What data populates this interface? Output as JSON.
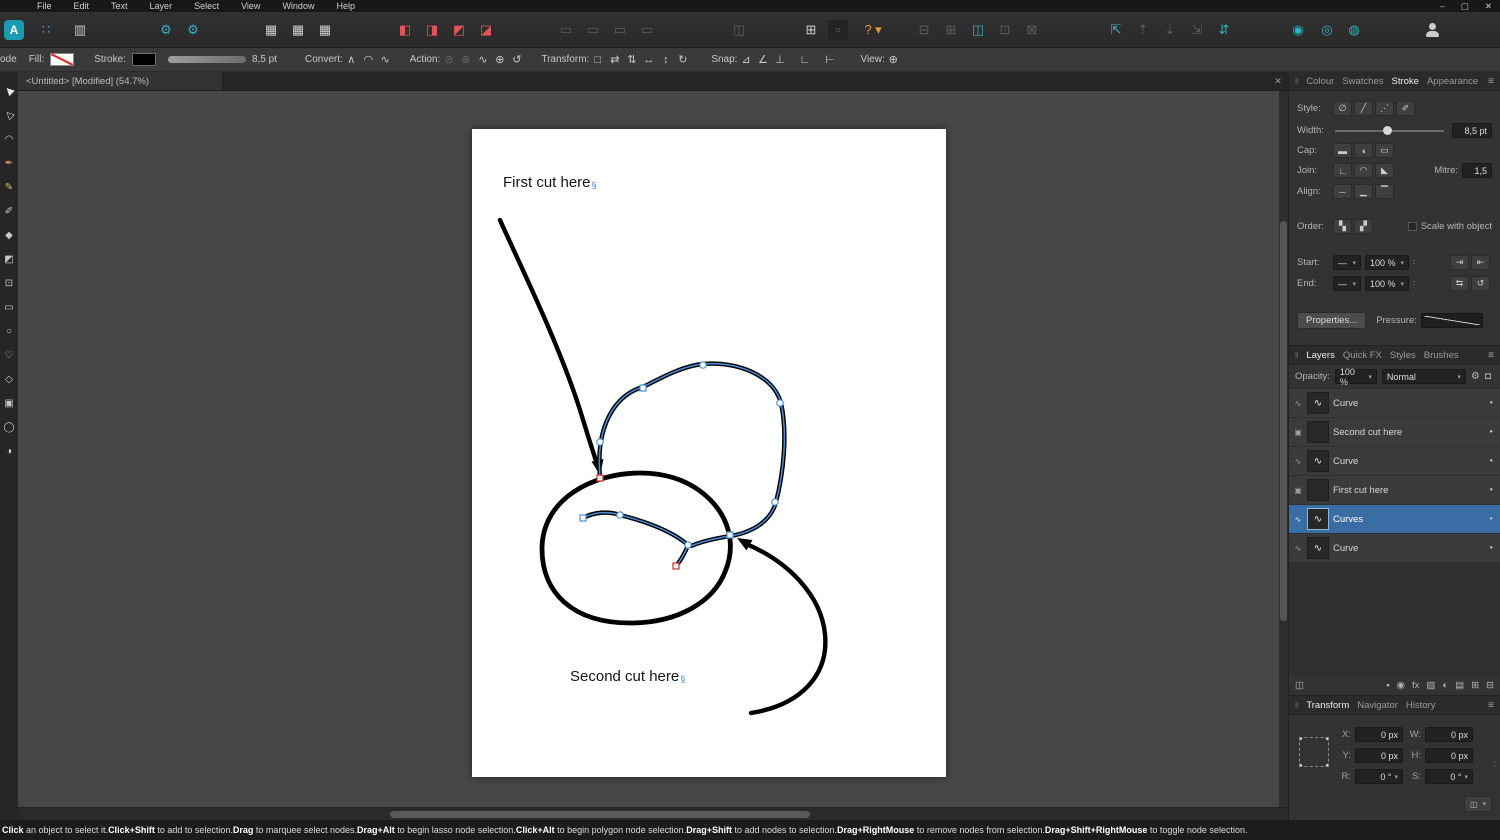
{
  "ui": {
    "hamburger": "≡",
    "grip": "‖",
    "dd_arrow": "▾",
    "visibility_dot": "●",
    "tab_close": "✕",
    "sync": "∶"
  },
  "window": {
    "controls": [
      {
        "name": "minimize-button",
        "glyph": "–"
      },
      {
        "name": "maximize-button",
        "glyph": "▢"
      },
      {
        "name": "close-button",
        "glyph": "✕"
      }
    ]
  },
  "menubar": {
    "items": [
      {
        "name": "menu-file",
        "label": "File"
      },
      {
        "name": "menu-edit",
        "label": "Edit"
      },
      {
        "name": "menu-text",
        "label": "Text"
      },
      {
        "name": "menu-layer",
        "label": "Layer"
      },
      {
        "name": "menu-select",
        "label": "Select"
      },
      {
        "name": "menu-view",
        "label": "View"
      },
      {
        "name": "menu-window",
        "label": "Window"
      },
      {
        "name": "menu-help",
        "label": "Help"
      }
    ]
  },
  "toolbar": {
    "icons": [
      {
        "name": "app-logo",
        "glyph": "A",
        "color": "#ffffff",
        "bg": "#1b9ab0",
        "gap": 4,
        "cls": "logo"
      },
      {
        "name": "apps-grid-icon",
        "glyph": "∷",
        "color": "#4fa3e3",
        "gap": 12
      },
      {
        "name": "document-stats-icon",
        "glyph": "▥",
        "color": "#c9c9c9",
        "gap": 14
      },
      {
        "name": "preferences-gear-icon",
        "glyph": "⚙",
        "color": "#2fb3c4",
        "gap": 66
      },
      {
        "name": "settings-gear-icon",
        "glyph": "⚙",
        "color": "#2fb3c4",
        "gap": 7
      },
      {
        "name": "grid-manager-icon",
        "glyph": "▦",
        "color": "#cfcfcf",
        "gap": 58
      },
      {
        "name": "grid-table-icon",
        "glyph": "▦",
        "color": "#cfcfcf",
        "gap": 7
      },
      {
        "name": "guides-icon",
        "glyph": "▦",
        "color": "#cfcfcf",
        "gap": 7
      },
      {
        "name": "boolean-add-icon",
        "glyph": "◧",
        "color": "#e05555",
        "gap": 60
      },
      {
        "name": "boolean-subtract-icon",
        "glyph": "◨",
        "color": "#e05555",
        "gap": 7
      },
      {
        "name": "boolean-intersect-icon",
        "glyph": "◩",
        "color": "#e05555",
        "gap": 7
      },
      {
        "name": "boolean-divide-icon",
        "glyph": "◪",
        "color": "#e05555",
        "gap": 7
      },
      {
        "name": "insert-behind-icon",
        "glyph": "▭",
        "color": "#5e5e5e",
        "gap": 60
      },
      {
        "name": "insert-top-icon",
        "glyph": "▭",
        "color": "#5e5e5e",
        "gap": 7
      },
      {
        "name": "insert-inside-icon",
        "glyph": "▭",
        "color": "#5e5e5e",
        "gap": 7
      },
      {
        "name": "insert-after-icon",
        "glyph": "▭",
        "color": "#5e5e5e",
        "gap": 7
      },
      {
        "name": "replace-selection-icon",
        "glyph": "◫",
        "color": "#5e5e5e",
        "gap": 72
      },
      {
        "name": "snapping-toggle-icon",
        "glyph": "⊞",
        "color": "#cfcfcf",
        "gap": 52
      },
      {
        "name": "snapping-preset-box",
        "glyph": "▫",
        "color": "#777777",
        "bg": "#232323",
        "gap": 7
      },
      {
        "name": "help-icon",
        "glyph": "? ▾",
        "color": "#e09a3e",
        "gap": 10,
        "w": 30
      },
      {
        "name": "selection-box-icon",
        "glyph": "⊟",
        "color": "#5e5e5e",
        "gap": 26
      },
      {
        "name": "selection-cycle-icon",
        "glyph": "⊞",
        "color": "#5e5e5e",
        "gap": 7
      },
      {
        "name": "edit-in-photo-icon",
        "glyph": "◫",
        "color": "#39aebc",
        "gap": 7
      },
      {
        "name": "rotate-left-icon",
        "glyph": "⊡",
        "color": "#5e5e5e",
        "gap": 7
      },
      {
        "name": "rotate-right-icon",
        "glyph": "⊠",
        "color": "#5e5e5e",
        "gap": 7
      },
      {
        "name": "arrange-to-front-icon",
        "glyph": "⇱",
        "color": "#39aebc",
        "gap": 64
      },
      {
        "name": "arrange-forward-icon",
        "glyph": "⇡",
        "color": "#5e5e5e",
        "gap": 7
      },
      {
        "name": "arrange-backward-icon",
        "glyph": "⇣",
        "color": "#5e5e5e",
        "gap": 7
      },
      {
        "name": "arrange-to-back-icon",
        "glyph": "⇲",
        "color": "#5e5e5e",
        "gap": 7
      },
      {
        "name": "arrange-order-icon",
        "glyph": "⇵",
        "color": "#39aebc",
        "gap": 7
      },
      {
        "name": "designer-persona-icon",
        "glyph": "◉",
        "color": "#2fb3c4",
        "gap": 54
      },
      {
        "name": "pixel-persona-icon",
        "glyph": "◎",
        "color": "#2fb3c4",
        "gap": 9
      },
      {
        "name": "export-persona-icon",
        "glyph": "◍",
        "color": "#2fb3c4",
        "gap": 7
      },
      {
        "name": "account-icon",
        "glyph": "",
        "color": "#cfcfcf",
        "gap": 58,
        "cls": "person"
      }
    ]
  },
  "context_bar": {
    "mode_label": "ode",
    "fill_label": "Fill:",
    "stroke_label": "Stroke:",
    "stroke_width_value": "8,5 pt",
    "convert_label": "Convert:",
    "convert_icons": [
      {
        "name": "convert-sharp-icon",
        "glyph": "∧"
      },
      {
        "name": "convert-smooth-icon",
        "glyph": "◠"
      },
      {
        "name": "convert-smart-icon",
        "glyph": "∿"
      }
    ],
    "action_label": "Action:",
    "action_icons": [
      {
        "name": "action-close-curve-icon",
        "glyph": "⊘",
        "dim": true
      },
      {
        "name": "action-break-curve-icon",
        "glyph": "⊗",
        "dim": true
      },
      {
        "name": "action-smooth-icon",
        "glyph": "∿"
      },
      {
        "name": "action-join-curves-icon",
        "glyph": "⊕"
      },
      {
        "name": "action-reverse-curves-icon",
        "glyph": "↺"
      }
    ],
    "transform_label": "Transform:",
    "transform_icons": [
      {
        "name": "bounding-box-icon",
        "glyph": "□"
      },
      {
        "name": "flip-horizontal-icon",
        "glyph": "⇄"
      },
      {
        "name": "flip-vertical-icon",
        "glyph": "⇅"
      },
      {
        "name": "scale-h-icon",
        "glyph": "↔"
      },
      {
        "name": "scale-v-icon",
        "glyph": "↕"
      },
      {
        "name": "rotate-icon",
        "glyph": "↻"
      }
    ],
    "snap_label": "Snap:",
    "snap_icons": [
      {
        "name": "snap-to-geometry-icon",
        "glyph": "⊿"
      },
      {
        "name": "snap-off-curve-icon",
        "glyph": "∠"
      },
      {
        "name": "snap-construct-icon",
        "glyph": "⊥"
      },
      {
        "name": "snap-alignment-icon",
        "glyph": "∟",
        "gap": 8
      },
      {
        "name": "snap-perpendicular-icon",
        "glyph": "⊢",
        "gap": 8
      }
    ],
    "view_label": "View:",
    "view_icons": [
      {
        "name": "view-points-icon",
        "glyph": "⊕"
      }
    ]
  },
  "document": {
    "tab_title": "<Untitled> [Modified] (54.7%)"
  },
  "tools": {
    "items": [
      {
        "name": "move-tool",
        "glyph": "▶",
        "color": "#e8e8e8",
        "rot": -135
      },
      {
        "name": "node-tool",
        "glyph": "▷",
        "color": "#d8d8d8",
        "rot": -135
      },
      {
        "name": "corner-tool",
        "glyph": "◠",
        "color": "#c9c9c9"
      },
      {
        "name": "pen-tool",
        "glyph": "✒",
        "color": "#d98b5a"
      },
      {
        "name": "pencil-tool",
        "glyph": "✎",
        "color": "#d8c25a"
      },
      {
        "name": "vector-brush-tool",
        "glyph": "✐",
        "color": "#c9c9c9"
      },
      {
        "name": "fill-tool",
        "glyph": "◆",
        "color": "#c9c9c9"
      },
      {
        "name": "transparency-tool",
        "glyph": "◩",
        "color": "#c9c9c9"
      },
      {
        "name": "vector-crop-tool",
        "glyph": "⊡",
        "color": "#c9c9c9"
      },
      {
        "name": "rectangle-tool",
        "glyph": "▭",
        "color": "#c9c9c9"
      },
      {
        "name": "ellipse-tool",
        "glyph": "○",
        "color": "#c9c9c9"
      },
      {
        "name": "heart-shape-tool",
        "glyph": "♡",
        "color": "#c9c9c9"
      },
      {
        "name": "shape-tool",
        "glyph": "◇",
        "color": "#c9c9c9"
      },
      {
        "name": "text-tool",
        "glyph": "▣",
        "color": "#c9c9c9"
      },
      {
        "name": "zoom-tool",
        "glyph": "◯",
        "color": "#c9c9c9"
      },
      {
        "name": "colour-selector-tool",
        "glyph": "◑",
        "color": "#e0e0e0"
      }
    ]
  },
  "canvas": {
    "first_label": "First cut here",
    "second_label": "Second cut here",
    "overflow_marker": "§"
  },
  "stroke_panel": {
    "tabs": [
      {
        "name": "tab-colour",
        "label": "Colour"
      },
      {
        "name": "tab-swatches",
        "label": "Swatches"
      },
      {
        "name": "tab-stroke",
        "label": "Stroke",
        "active": true
      },
      {
        "name": "tab-appearance",
        "label": "Appearance"
      }
    ],
    "style_label": "Style:",
    "style_buttons": [
      {
        "name": "no-stroke-icon",
        "glyph": "∅"
      },
      {
        "name": "solid-stroke-icon",
        "glyph": "╱"
      },
      {
        "name": "dash-stroke-icon",
        "glyph": "⋰"
      },
      {
        "name": "brush-stroke-icon",
        "glyph": "✐"
      }
    ],
    "width_label": "Width:",
    "width_value": "8,5 pt",
    "cap_label": "Cap:",
    "cap_buttons": [
      {
        "name": "butt-cap-icon",
        "glyph": "▬"
      },
      {
        "name": "round-cap-icon",
        "glyph": "◖"
      },
      {
        "name": "square-cap-icon",
        "glyph": "▭"
      }
    ],
    "join_label": "Join:",
    "join_buttons": [
      {
        "name": "mitre-join-icon",
        "glyph": "∟"
      },
      {
        "name": "round-join-icon",
        "glyph": "◠"
      },
      {
        "name": "bevel-join-icon",
        "glyph": "◣"
      }
    ],
    "mitre_label": "Mitre:",
    "mitre_value": "1,5",
    "align_label": "Align:",
    "align_buttons": [
      {
        "name": "align-centre-icon",
        "glyph": "─"
      },
      {
        "name": "align-inside-icon",
        "glyph": "▁"
      },
      {
        "name": "align-outside-icon",
        "glyph": "▔"
      }
    ],
    "order_label": "Order:",
    "order_buttons": [
      {
        "name": "stroke-behind-fill-icon",
        "glyph": "▚"
      },
      {
        "name": "stroke-in-front-icon",
        "glyph": "▞"
      }
    ],
    "scale_with_object_label": "Scale with object",
    "start_label": "Start:",
    "end_label": "End:",
    "start_style_value": "—",
    "start_pct_value": "100 %",
    "end_style_value": "—",
    "end_pct_value": "100 %",
    "start_buttons": [
      {
        "name": "arrowhead-start-icon",
        "glyph": "⇥"
      },
      {
        "name": "arrowhead-end-icon",
        "glyph": "⇤"
      }
    ],
    "end_buttons": [
      {
        "name": "swap-ends-icon",
        "glyph": "⇆"
      },
      {
        "name": "reverse-curve-icon",
        "glyph": "↺"
      }
    ],
    "properties_button": "Properties...",
    "pressure_label": "Pressure:"
  },
  "layers_panel": {
    "tabs": [
      {
        "name": "tab-layers",
        "label": "Layers",
        "active": true
      },
      {
        "name": "tab-quick-fx",
        "label": "Quick FX"
      },
      {
        "name": "tab-styles",
        "label": "Styles"
      },
      {
        "name": "tab-brushes",
        "label": "Brushes"
      }
    ],
    "opacity_label": "Opacity:",
    "opacity_value": "100 %",
    "blend_value": "Normal",
    "gear_glyph": "⚙",
    "lock_glyph": "◘",
    "rows": [
      {
        "badge": "∿",
        "thumb": "∿",
        "name": "Curve"
      },
      {
        "badge": "▣",
        "thumb": "",
        "name": "Second cut here"
      },
      {
        "badge": "∿",
        "thumb": "∿",
        "name": "Curve"
      },
      {
        "badge": "▣",
        "thumb": "",
        "name": "First cut here"
      },
      {
        "badge": "∿",
        "thumb": "∿",
        "name": "Curves",
        "selected": true
      },
      {
        "badge": "∿",
        "thumb": "∿",
        "name": "Curve"
      }
    ],
    "footer_left": [
      {
        "name": "duplicate-layer-icon",
        "glyph": "◫"
      }
    ],
    "footer_right": [
      {
        "name": "fill-layer-icon",
        "glyph": "▪"
      },
      {
        "name": "adjustment-icon",
        "glyph": "◉"
      },
      {
        "name": "layer-effects-icon",
        "glyph": "fx"
      },
      {
        "name": "mask-layer-icon",
        "glyph": "▨"
      },
      {
        "name": "clip-layer-icon",
        "glyph": "◐"
      },
      {
        "name": "group-layers-icon",
        "glyph": "▤"
      },
      {
        "name": "new-layer-icon",
        "glyph": "⊞"
      },
      {
        "name": "delete-layer-icon",
        "glyph": "⊟"
      }
    ]
  },
  "transform_panel": {
    "tabs": [
      {
        "name": "tab-transform",
        "label": "Transform",
        "active": true
      },
      {
        "name": "tab-navigator",
        "label": "Navigator"
      },
      {
        "name": "tab-history",
        "label": "History"
      }
    ],
    "fields": [
      {
        "label": "X:",
        "value": "0 px"
      },
      {
        "label": "W:",
        "value": "0 px"
      },
      {
        "label": "Y:",
        "value": "0 px"
      },
      {
        "label": "H:",
        "value": "0 px"
      },
      {
        "label": "R:",
        "value": "0 °",
        "cls": "dd"
      },
      {
        "label": "S:",
        "value": "0 °",
        "cls": "dd"
      }
    ],
    "link_glyph": "∶",
    "corner_glyph": "◫"
  },
  "status_bar": {
    "segments": [
      {
        "b": "Click",
        "t": " an object to select it. "
      },
      {
        "b": "Click+Shift",
        "t": " to add to selection. "
      },
      {
        "b": "Drag",
        "t": " to marquee select nodes. "
      },
      {
        "b": "Drag+Alt",
        "t": " to begin lasso node selection. "
      },
      {
        "b": "Click+Alt",
        "t": " to begin polygon node selection. "
      },
      {
        "b": "Drag+Shift",
        "t": " to add nodes to selection. "
      },
      {
        "b": "Drag+RightMouse",
        "t": " to remove nodes from selection. "
      },
      {
        "b": "Drag+Shift+RightMouse",
        "t": " to toggle node selection."
      }
    ]
  }
}
